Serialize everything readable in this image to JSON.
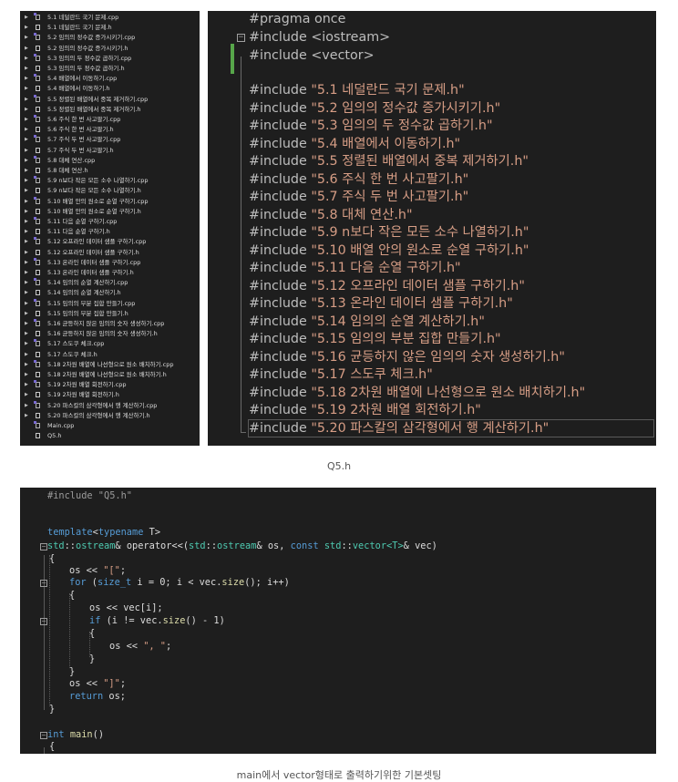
{
  "explorer": {
    "items": [
      {
        "label": "5.1 네덜란드 국기 문제.cpp",
        "type": "cpp"
      },
      {
        "label": "5.1 네덜란드 국기 문제.h",
        "type": "h"
      },
      {
        "label": "5.2 임의의 정수값 증가시키기.cpp",
        "type": "cpp"
      },
      {
        "label": "5.2 임의의 정수값 증가시키기.h",
        "type": "h"
      },
      {
        "label": "5.3 임의의 두 정수값 곱하기.cpp",
        "type": "cpp"
      },
      {
        "label": "5.3 임의의 두 정수값 곱하기.h",
        "type": "h"
      },
      {
        "label": "5.4 배열에서 이동하기.cpp",
        "type": "cpp"
      },
      {
        "label": "5.4 배열에서 이동하기.h",
        "type": "h"
      },
      {
        "label": "5.5 정렬된 배열에서 중복 제거하기.cpp",
        "type": "cpp"
      },
      {
        "label": "5.5 정렬된 배열에서 중복 제거하기.h",
        "type": "h"
      },
      {
        "label": "5.6 주식 한 번 사고팔기.cpp",
        "type": "cpp"
      },
      {
        "label": "5.6 주식 한 번 사고팔기.h",
        "type": "h"
      },
      {
        "label": "5.7 주식 두 번 사고팔기.cpp",
        "type": "cpp"
      },
      {
        "label": "5.7 주식 두 번 사고팔기.h",
        "type": "h"
      },
      {
        "label": "5.8 대체 연산.cpp",
        "type": "cpp"
      },
      {
        "label": "5.8 대체 연산.h",
        "type": "h"
      },
      {
        "label": "5.9 n보다 작은 모든 소수 나열하기.cpp",
        "type": "cpp"
      },
      {
        "label": "5.9 n보다 작은 모든 소수 나열하기.h",
        "type": "h"
      },
      {
        "label": "5.10 배열 안의 원소로 순열 구하기.cpp",
        "type": "cpp"
      },
      {
        "label": "5.10 배열 안의 원소로 순열 구하기.h",
        "type": "h"
      },
      {
        "label": "5.11 다음 순열 구하기.cpp",
        "type": "cpp"
      },
      {
        "label": "5.11 다음 순열 구하기.h",
        "type": "h"
      },
      {
        "label": "5.12 오프라인 데이터 샘플 구하기.cpp",
        "type": "cpp"
      },
      {
        "label": "5.12 오프라인 데이터 샘플 구하기.h",
        "type": "h"
      },
      {
        "label": "5.13 온라인 데이터 샘플 구하기.cpp",
        "type": "cpp"
      },
      {
        "label": "5.13 온라인 데이터 샘플 구하기.h",
        "type": "h"
      },
      {
        "label": "5.14 임의의 순열 계산하기.cpp",
        "type": "cpp"
      },
      {
        "label": "5.14 임의의 순열 계산하기.h",
        "type": "h"
      },
      {
        "label": "5.15 임의의 부분 집합 만들기.cpp",
        "type": "cpp"
      },
      {
        "label": "5.15 임의의 부분 집합 만들기.h",
        "type": "h"
      },
      {
        "label": "5.16 균등하지 않은 임의의 숫자 생성하기.cpp",
        "type": "cpp"
      },
      {
        "label": "5.16 균등하지 않은 임의의 숫자 생성하기.h",
        "type": "h"
      },
      {
        "label": "5.17 스도쿠 체크.cpp",
        "type": "cpp"
      },
      {
        "label": "5.17 스도쿠 체크.h",
        "type": "h"
      },
      {
        "label": "5.18 2차원 배열에 나선형으로 원소 배치하기.cpp",
        "type": "cpp"
      },
      {
        "label": "5.18 2차원 배열에 나선형으로 원소 배치하기.h",
        "type": "h"
      },
      {
        "label": "5.19 2차원 배열 회전하기.cpp",
        "type": "cpp"
      },
      {
        "label": "5.19 2차원 배열 회전하기.h",
        "type": "h"
      },
      {
        "label": "5.20 파스칼의 삼각형에서 행 계산하기.cpp",
        "type": "cpp"
      },
      {
        "label": "5.20 파스칼의 삼각형에서 행 계산하기.h",
        "type": "h"
      },
      {
        "label": "Main.cpp",
        "type": "cpp"
      },
      {
        "label": "Q5.h",
        "type": "h"
      }
    ]
  },
  "top_code": {
    "pragma": "#pragma once",
    "inc_iostream": [
      "#include ",
      "<iostream>"
    ],
    "inc_vector": [
      "#include ",
      "<vector>"
    ],
    "includes": [
      "\"5.1 네덜란드 국기 문제.h\"",
      "\"5.2 임의의 정수값 증가시키기.h\"",
      "\"5.3 임의의 두 정수값 곱하기.h\"",
      "\"5.4 배열에서 이동하기.h\"",
      "\"5.5 정렬된 배열에서 중복 제거하기.h\"",
      "\"5.6 주식 한 번 사고팔기.h\"",
      "\"5.7 주식 두 번 사고팔기.h\"",
      "\"5.8 대체 연산.h\"",
      "\"5.9 n보다 작은 모든 소수 나열하기.h\"",
      "\"5.10 배열 안의 원소로 순열 구하기.h\"",
      "\"5.11 다음 순열 구하기.h\"",
      "\"5.12 오프라인 데이터 샘플 구하기.h\"",
      "\"5.13 온라인 데이터 샘플 구하기.h\"",
      "\"5.14 임의의 순열 계산하기.h\"",
      "\"5.15 임의의 부분 집합 만들기.h\"",
      "\"5.16 균등하지 않은 임의의 숫자 생성하기.h\"",
      "\"5.17 스도쿠 체크.h\"",
      "\"5.18 2차원 배열에 나선형으로 원소 배치하기.h\"",
      "\"5.19 2차원 배열 회전하기.h\"",
      "\"5.20 파스칼의 삼각형에서 행 계산하기.h\""
    ],
    "include_kw": "#include "
  },
  "caption_top": "Q5.h",
  "caption_bottom": "main에서 vector형태로 출력하기위한 기본셋팅",
  "bottom_code": {
    "l_include": "#include \"Q5.h\"",
    "l_template_kw": "template",
    "l_template_lt": "<",
    "l_typename": "typename",
    "l_template_rest": " T>",
    "l_sig_std1": "std",
    "l_sig_sep1": "::",
    "l_sig_ostream1": "ostream",
    "l_sig_mid": "& operator<<(",
    "l_sig_std2": "std",
    "l_sig_sep2": "::",
    "l_sig_ostream2": "ostream",
    "l_sig_mid2": "& os, ",
    "l_sig_const": "const",
    "l_sig_sp": " ",
    "l_sig_std3": "std",
    "l_sig_sep3": "::",
    "l_sig_vector": "vector",
    "l_sig_tmpl": "<T>",
    "l_sig_end": "& vec)",
    "l_open1": "{",
    "l_os1_a": "os << ",
    "l_os1_b": "\"[\"",
    "l_os1_c": ";",
    "l_for_kw": "for",
    "l_for_a": " (",
    "l_for_size_t": "size_t",
    "l_for_b": " i = 0; i < vec.",
    "l_for_size": "size",
    "l_for_c": "(); i++)",
    "l_open2": "{",
    "l_os2": "os << vec[i];",
    "l_if_kw": "if",
    "l_if_a": " (i != vec.",
    "l_if_size": "size",
    "l_if_b": "() - 1)",
    "l_open3": "{",
    "l_os3_a": "os << ",
    "l_os3_b": "\", \"",
    "l_os3_c": ";",
    "l_close3": "}",
    "l_close2": "}",
    "l_os4_a": "os << ",
    "l_os4_b": "\"]\"",
    "l_os4_c": ";",
    "l_return_kw": "return",
    "l_return_rest": " os;",
    "l_close1": "}",
    "l_main_kw": "int",
    "l_main_sp": " ",
    "l_main_fn": "main",
    "l_main_rest": "()",
    "l_open_main": "{"
  },
  "colors": {
    "editor_bg": "#1e1e1e",
    "keyword": "#569cd6",
    "type": "#4ec9b0",
    "string": "#d69d85",
    "function": "#dcdcaa",
    "change_bar": "#57a64a"
  }
}
